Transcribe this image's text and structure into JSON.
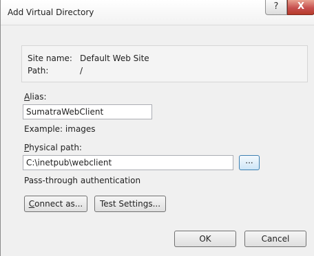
{
  "window": {
    "title": "Add Virtual Directory",
    "help_glyph": "?",
    "close_glyph": "X"
  },
  "info": {
    "site_name_label": "Site name:",
    "site_name_value": "Default Web Site",
    "path_label": "Path:",
    "path_value": "/"
  },
  "alias": {
    "label_accel": "A",
    "label_rest": "lias:",
    "value": "SumatraWebClient",
    "example": "Example: images"
  },
  "physical_path": {
    "label_accel": "P",
    "label_rest": "hysical path:",
    "value": "C:\\inetpub\\webclient",
    "browse_label": "..."
  },
  "auth": {
    "text": "Pass-through authentication"
  },
  "buttons": {
    "connect_accel": "C",
    "connect_rest": "onnect as...",
    "test_settings": "Test Settings...",
    "ok": "OK",
    "cancel": "Cancel"
  }
}
